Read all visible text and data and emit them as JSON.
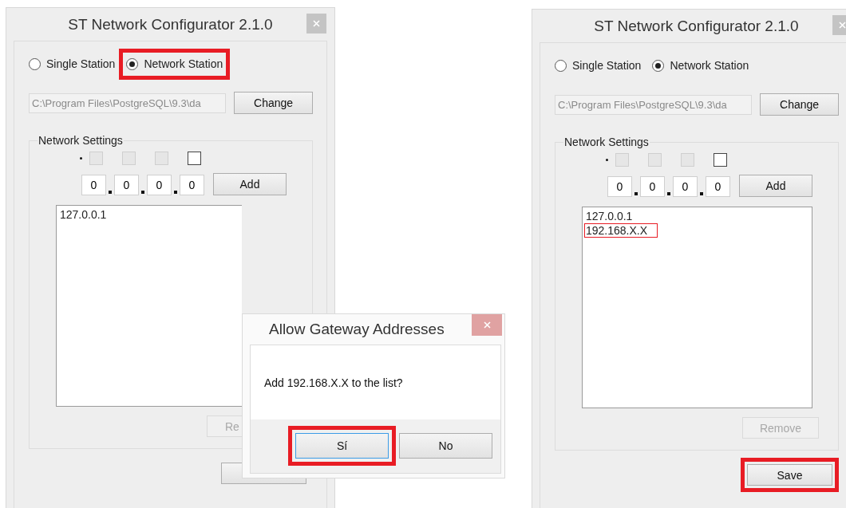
{
  "windows": [
    {
      "title": "ST Network Configurator 2.1.0",
      "radios": [
        {
          "label": "Single Station",
          "selected": false,
          "highlighted": false
        },
        {
          "label": "Network Station",
          "selected": true,
          "highlighted": true
        }
      ],
      "path_field": {
        "value": "C:\\Program Files\\PostgreSQL\\9.3\\da",
        "disabled": true
      },
      "change_button": "Change",
      "group_title": "Network Settings",
      "octet_checks": [
        {
          "disabled": true
        },
        {
          "disabled": true
        },
        {
          "disabled": true
        },
        {
          "disabled": false
        }
      ],
      "octets": [
        "0",
        "0",
        "0",
        "0"
      ],
      "add_button": "Add",
      "addresses": [
        {
          "text": "127.0.0.1",
          "highlighted": false
        }
      ],
      "remove_button": {
        "label": "Re",
        "disabled": true
      },
      "save_button": {
        "highlighted": false
      }
    },
    {
      "title": "ST Network Configurator 2.1.0",
      "radios": [
        {
          "label": "Single Station",
          "selected": false,
          "highlighted": false
        },
        {
          "label": "Network Station",
          "selected": true,
          "highlighted": false
        }
      ],
      "path_field": {
        "value": "C:\\Program Files\\PostgreSQL\\9.3\\da",
        "disabled": true
      },
      "change_button": "Change",
      "group_title": "Network Settings",
      "octet_checks": [
        {
          "disabled": true
        },
        {
          "disabled": true
        },
        {
          "disabled": true
        },
        {
          "disabled": false
        }
      ],
      "octets": [
        "0",
        "0",
        "0",
        "0"
      ],
      "add_button": "Add",
      "addresses": [
        {
          "text": "127.0.0.1",
          "highlighted": false
        },
        {
          "text": "192.168.X.X",
          "highlighted": true
        }
      ],
      "remove_button": {
        "label": "Remove",
        "disabled": true
      },
      "save_button": {
        "label": "Save",
        "highlighted": true
      }
    }
  ],
  "dialog": {
    "title": "Allow Gateway Addresses",
    "message": "Add 192.168.X.X to the list?",
    "buttons": [
      {
        "label": "Sí",
        "focused": true,
        "highlighted": true
      },
      {
        "label": "No",
        "focused": false,
        "highlighted": false
      }
    ]
  }
}
